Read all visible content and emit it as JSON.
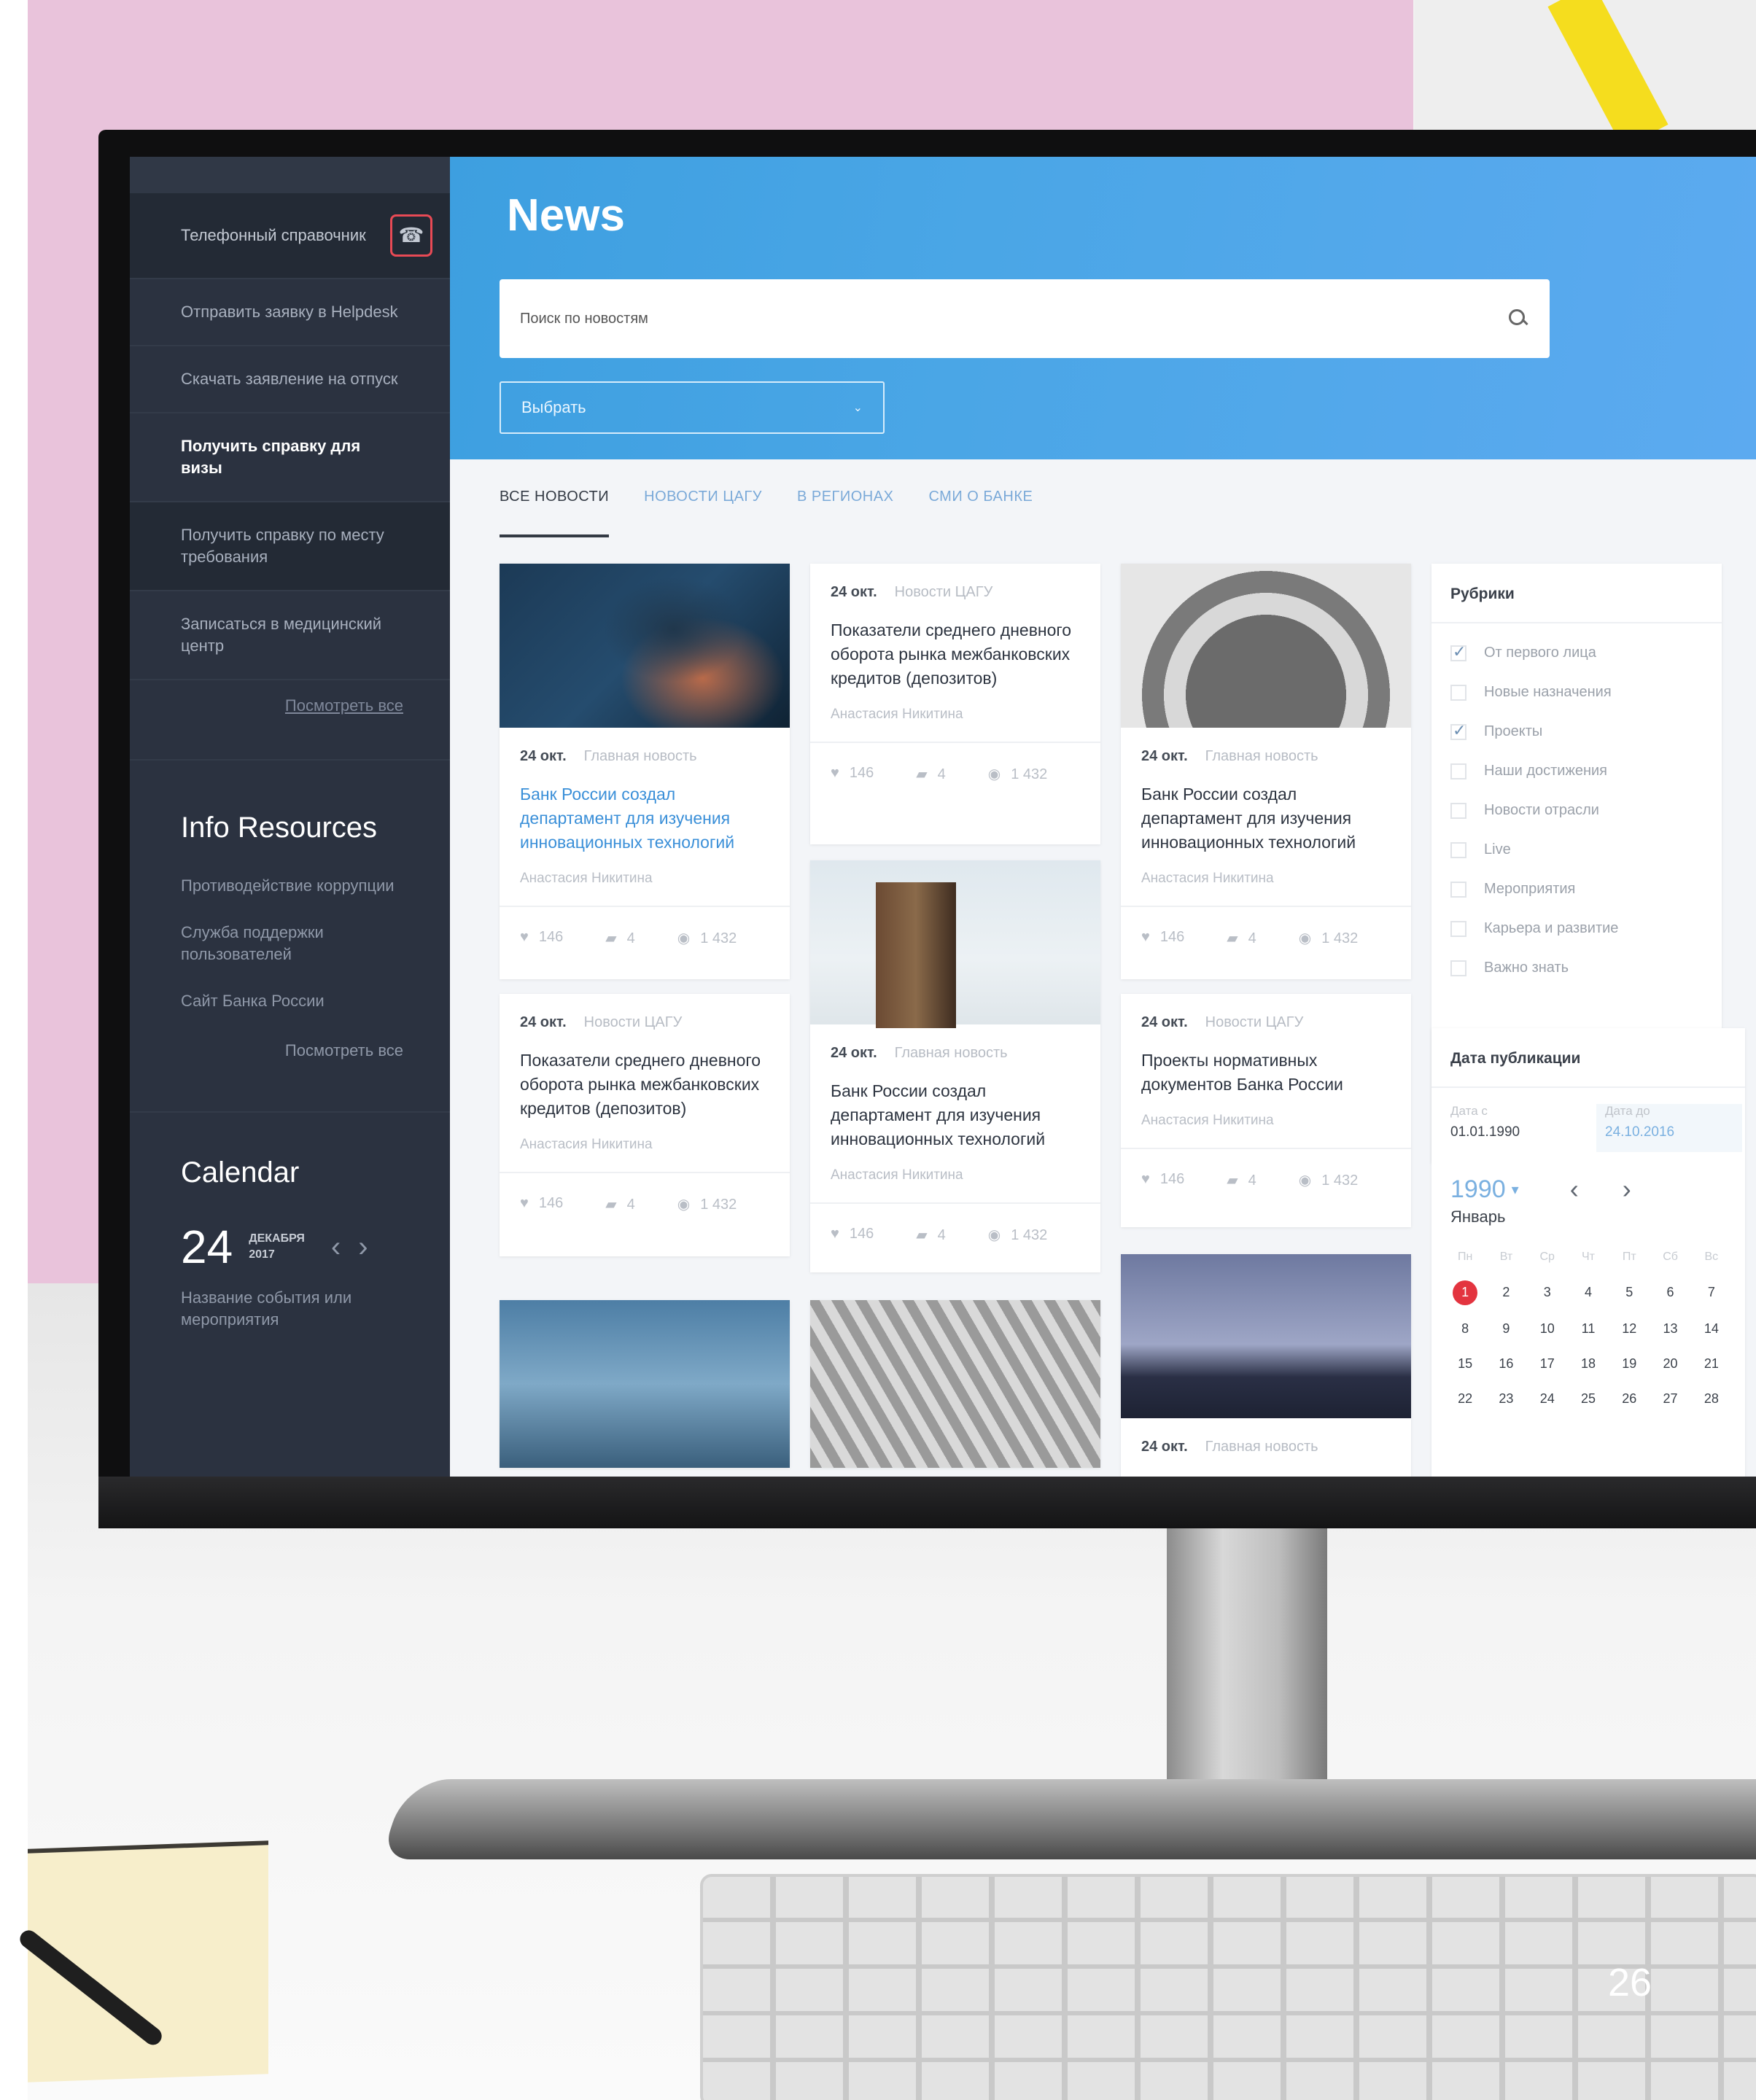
{
  "header": {
    "title": "News",
    "search_placeholder": "Поиск по новостям",
    "select_label": "Выбрать"
  },
  "tabs": [
    "ВСЕ НОВОСТИ",
    "НОВОСТИ ЦАГУ",
    "В РЕГИОНАХ",
    "СМИ О БАНКЕ"
  ],
  "sidebar": {
    "items": [
      "Телефонный справочник",
      "Отправить заявку в Helpdesk",
      "Скачать заявление на отпуск",
      "Получить справку для визы",
      "Получить справку по месту требования",
      "Записаться в медицинский центр"
    ],
    "see_all": "Посмотреть все",
    "info_title": "Info Resources",
    "info_links": [
      "Противодействие коррупции",
      "Служба поддержки пользователей",
      "Сайт Банка России"
    ],
    "info_see_all": "Посмотреть все",
    "calendar_title": "Calendar",
    "calendar_day": "24",
    "calendar_month": "ДЕКАБРЯ",
    "calendar_year": "2017",
    "calendar_event": "Название события или мероприятия"
  },
  "cards": [
    {
      "date": "24 окт.",
      "category": "Главная новость",
      "title": "Банк России создал департамент для изучения инновационных технологий",
      "author": "Анастасия Никитина",
      "likes": "146",
      "comments": "4",
      "views": "1 432"
    },
    {
      "date": "24 окт.",
      "category": "Новости ЦАГУ",
      "title": "Показатели среднего дневного оборота рынка межбанковских кредитов (депозитов)",
      "author": "Анастасия Никитина",
      "likes": "146",
      "comments": "4",
      "views": "1 432"
    },
    {
      "date": "24 окт.",
      "category": "Главная новость",
      "title": "Банк России создал департамент для изучения инновационных технологий",
      "author": "Анастасия Никитина",
      "likes": "146",
      "comments": "4",
      "views": "1 432"
    },
    {
      "date": "24 окт.",
      "category": "Новости ЦАГУ",
      "title": "Показатели среднего дневного оборота рынка межбанковских кредитов (депозитов)",
      "author": "Анастасия Никитина",
      "likes": "146",
      "comments": "4",
      "views": "1 432"
    },
    {
      "date": "24 окт.",
      "category": "Главная новость",
      "title": "Банк России создал департамент для изучения инновационных технологий",
      "author": "Анастасия Никитина",
      "likes": "146",
      "comments": "4",
      "views": "1 432"
    },
    {
      "date": "24 окт.",
      "category": "Новости ЦАГУ",
      "title": "Проекты нормативных документов Банка России",
      "author": "Анастасия Никитина",
      "likes": "146",
      "comments": "4",
      "views": "1 432"
    },
    {
      "date": "24 окт.",
      "category": "Главная новость"
    }
  ],
  "rubrics": {
    "title": "Рубрики",
    "items": [
      {
        "label": "От первого лица",
        "checked": true
      },
      {
        "label": "Новые назначения",
        "checked": false
      },
      {
        "label": "Проекты",
        "checked": true
      },
      {
        "label": "Наши достижения",
        "checked": false
      },
      {
        "label": "Новости отрасли",
        "checked": false
      },
      {
        "label": "Live",
        "checked": false
      },
      {
        "label": "Мероприятия",
        "checked": false
      },
      {
        "label": "Карьера и развитие",
        "checked": false
      },
      {
        "label": "Важно знать",
        "checked": false
      }
    ]
  },
  "publication": {
    "title": "Дата публикации",
    "from_label": "Дата с",
    "from_value": "01.01.1990",
    "to_label": "Дата до",
    "to_value": "24.10.2016",
    "year": "1990",
    "month": "Январь",
    "weekdays": [
      "Пн",
      "Вт",
      "Ср",
      "Чт",
      "Пт",
      "Сб",
      "Вс"
    ],
    "days": [
      "1",
      "2",
      "3",
      "4",
      "5",
      "6",
      "7",
      "8",
      "9",
      "10",
      "11",
      "12",
      "13",
      "14",
      "15",
      "16",
      "17",
      "18",
      "19",
      "20",
      "21",
      "22",
      "23",
      "24",
      "25",
      "26",
      "27",
      "28"
    ]
  },
  "page_number": "26",
  "colors": {
    "accent": "#3d9fe0",
    "sidebar": "#2b3240",
    "today": "#e3343f"
  }
}
